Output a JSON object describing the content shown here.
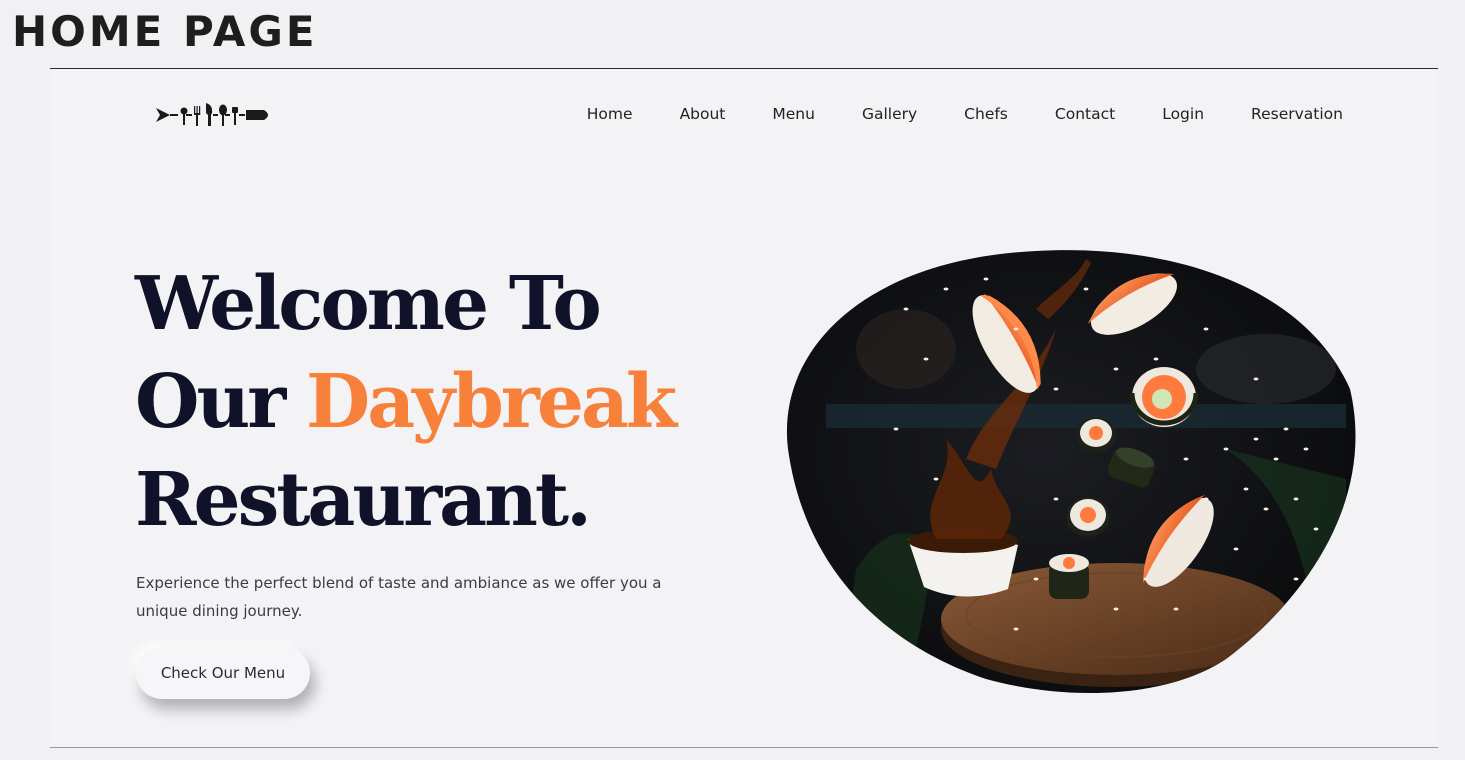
{
  "page": {
    "heading": "HOME PAGE"
  },
  "nav": {
    "items": [
      "Home",
      "About",
      "Menu",
      "Gallery",
      "Chefs",
      "Contact",
      "Login",
      "Reservation"
    ]
  },
  "hero": {
    "title_line1": "Welcome To",
    "title_line2_prefix": "Our ",
    "title_accent": "Daybreak",
    "title_line3": "Restaurant.",
    "description": "Experience the perfect blend of taste and ambiance as we offer you a unique dining journey.",
    "cta_label": "Check Our Menu"
  },
  "colors": {
    "accent": "#f7803b",
    "title": "#10122a",
    "background": "#f3f2f5"
  },
  "icons": {
    "logo": "cutlery-logo-icon",
    "hero": "flying-sushi-image"
  }
}
